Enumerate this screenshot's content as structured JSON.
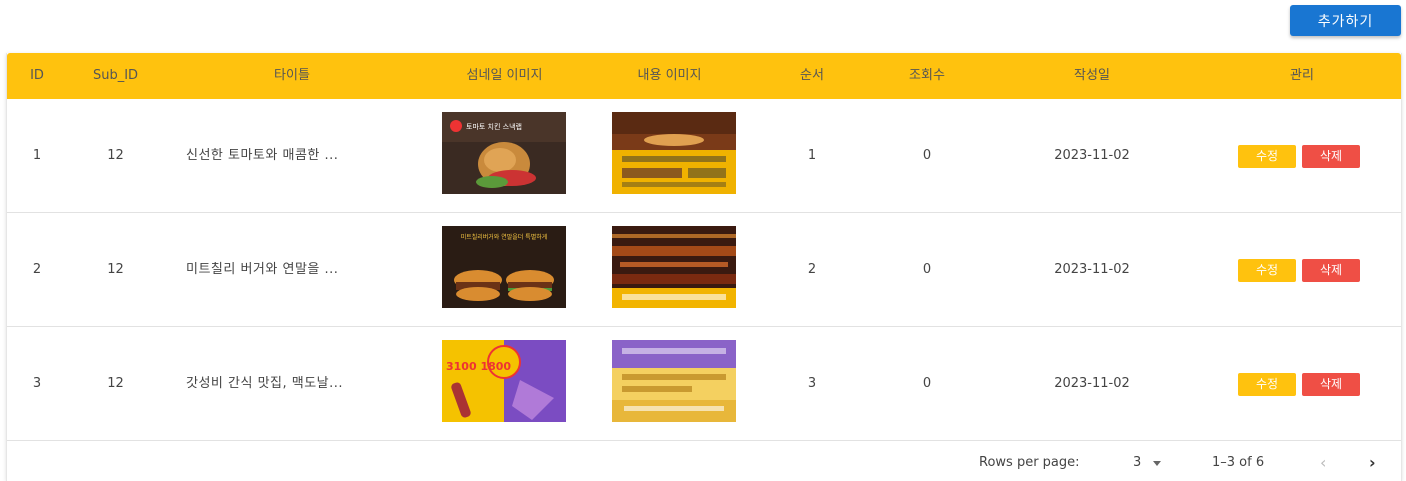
{
  "toolbar": {
    "add_label": "추가하기"
  },
  "table": {
    "headers": [
      "ID",
      "Sub_ID",
      "타이틀",
      "섬네일 이미지",
      "내용 이미지",
      "순서",
      "조회수",
      "작성일",
      "관리"
    ],
    "rows": [
      {
        "id": "1",
        "sub_id": "12",
        "title": "신선한 토마토와 매콤한 ...",
        "order": "1",
        "views": "0",
        "date": "2023-11-02",
        "thumb_caption": "토마토 치킨 스낵랩"
      },
      {
        "id": "2",
        "sub_id": "12",
        "title": "미트칠리 버거와 연말을 ...",
        "order": "2",
        "views": "0",
        "date": "2023-11-02",
        "thumb_caption": "미트칠리버거와 연말을더 특별하게"
      },
      {
        "id": "3",
        "sub_id": "12",
        "title": "갓성비 간식 맛집, 맥도날...",
        "order": "3",
        "views": "0",
        "date": "2023-11-02",
        "thumb_caption": "3100 1800"
      }
    ],
    "edit_label": "수정",
    "delete_label": "삭제"
  },
  "pagination": {
    "rows_per_page_label": "Rows per page:",
    "rows_per_page_value": "3",
    "range_text": "1–3 of 6",
    "prev_icon": "chevron-left-icon",
    "next_icon": "chevron-right-icon"
  },
  "colors": {
    "header_bg": "#ffc20e",
    "primary": "#1976d2",
    "edit": "#ffc20e",
    "delete": "#ef4f45"
  }
}
